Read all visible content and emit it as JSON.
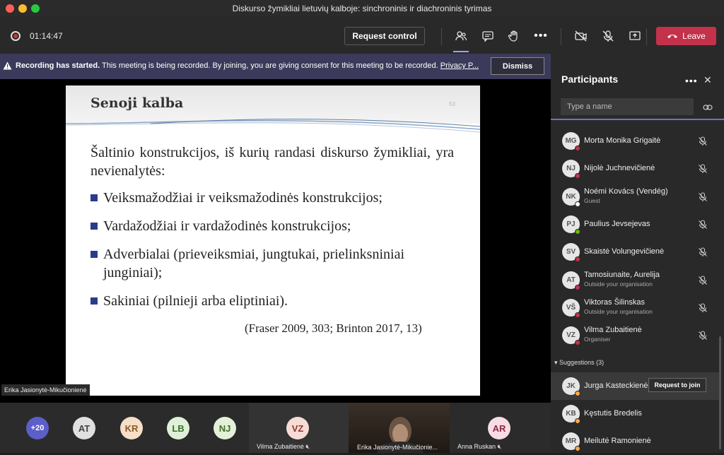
{
  "window": {
    "title": "Diskurso žymikliai lietuvių kalboje: sinchroninis ir diachroninis tyrimas"
  },
  "toolbar": {
    "timer": "01:14:47",
    "request_control": "Request control",
    "leave": "Leave",
    "icons": [
      "people-icon",
      "chat-icon",
      "raise-hand-icon",
      "more-icon",
      "camera-off-icon",
      "mic-off-icon",
      "share-icon"
    ]
  },
  "banner": {
    "bold": "Recording has started.",
    "text": "This meeting is being recorded. By joining, you are giving consent for this meeting to be recorded.",
    "link": "Privacy P...",
    "dismiss": "Dismiss"
  },
  "slide": {
    "title": "Senoji kalba",
    "number": "63",
    "intro": "Šaltinio konstrukcijos, iš kurių randasi diskurso žymikliai, yra nevienalytės:",
    "bullets": [
      "Veiksmažodžiai ir veiksmažodinės konstrukcijos;",
      "Vardažodžiai ir vardažodinės konstrukcijos;",
      "Adverbialai (prieveiksmiai, jungtukai, prielinksniniai junginiai);",
      "Sakiniai (pilnieji arba eliptiniai)."
    ],
    "citation": "(Fraser 2009, 303; Brinton 2017, 13)",
    "speaker": "Erika Jasionytė-Mikučionienė"
  },
  "strip": {
    "more_count": "+20",
    "avatars": [
      "AT",
      "KR",
      "LB",
      "NJ"
    ],
    "tiles": [
      {
        "initials": "VZ",
        "name": "Vilma Zubaitienė"
      },
      {
        "name": "Erika Jasionytė-Mikučionie..."
      },
      {
        "initials": "AR",
        "name": "Anna Ruskan"
      }
    ]
  },
  "panel": {
    "title": "Participants",
    "search_placeholder": "Type a name",
    "participants": [
      {
        "initials": "MG",
        "name": "Morta Monika Grigaitė",
        "sub": "",
        "status": "#c4314b"
      },
      {
        "initials": "NJ",
        "name": "Nijolė Juchnevičienė",
        "sub": "",
        "status": "#c4314b"
      },
      {
        "initials": "NK",
        "name": "Noémi Kovács (Vendég)",
        "sub": "Guest",
        "status": "#ffffff"
      },
      {
        "initials": "PJ",
        "name": "Paulius Jevsejevas",
        "sub": "",
        "status": "#6bb700"
      },
      {
        "initials": "SV",
        "name": "Skaistė Volungevičienė",
        "sub": "",
        "status": "#c4314b"
      },
      {
        "initials": "AT",
        "name": "Tamosiunaite, Aurelija",
        "sub": "Outside your organisation",
        "status": "#c4314b"
      },
      {
        "initials": "VŠ",
        "name": "Viktoras Šilinskas",
        "sub": "Outside your organisation",
        "status": "#c4314b"
      },
      {
        "initials": "VZ",
        "name": "Vilma Zubaitienė",
        "sub": "Organiser",
        "status": "#c4314b"
      }
    ],
    "suggestions_label": "Suggestions (3)",
    "suggestions": [
      {
        "initials": "JK",
        "name": "Jurga Kasteckienė",
        "status": "#ffaa44"
      },
      {
        "initials": "KB",
        "name": "Kęstutis Bredelis",
        "status": "#ffaa44"
      },
      {
        "initials": "MR",
        "name": "Meilutė Ramonienė",
        "status": "#ffaa44"
      }
    ],
    "request_to_join": "Request to join"
  }
}
